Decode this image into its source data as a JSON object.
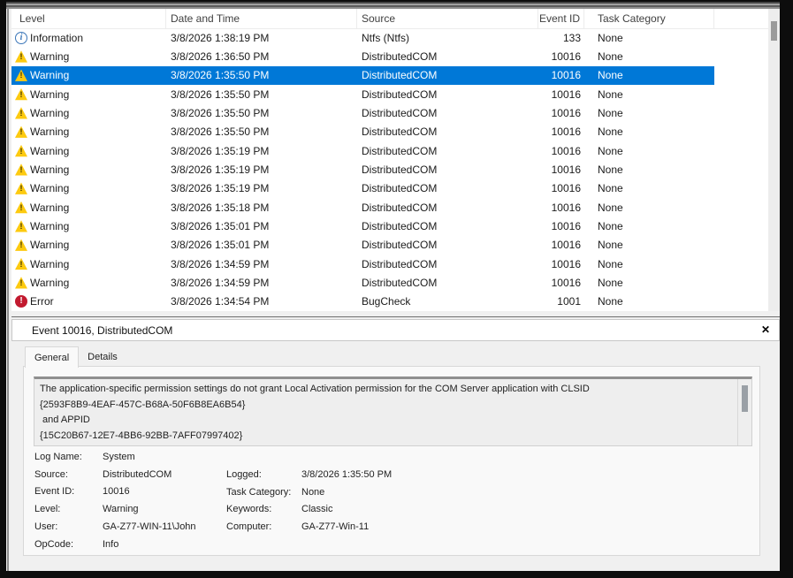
{
  "event_table": {
    "columns": [
      "Level",
      "Date and Time",
      "Source",
      "Event ID",
      "Task Category"
    ],
    "rows": [
      {
        "icon": "info",
        "level": "Information",
        "datetime": "3/8/2026 1:38:19 PM",
        "source": "Ntfs (Ntfs)",
        "event_id": "133",
        "task_category": "None",
        "selected": false
      },
      {
        "icon": "warning",
        "level": "Warning",
        "datetime": "3/8/2026 1:36:50 PM",
        "source": "DistributedCOM",
        "event_id": "10016",
        "task_category": "None",
        "selected": false
      },
      {
        "icon": "warning",
        "level": "Warning",
        "datetime": "3/8/2026 1:35:50 PM",
        "source": "DistributedCOM",
        "event_id": "10016",
        "task_category": "None",
        "selected": true
      },
      {
        "icon": "warning",
        "level": "Warning",
        "datetime": "3/8/2026 1:35:50 PM",
        "source": "DistributedCOM",
        "event_id": "10016",
        "task_category": "None",
        "selected": false
      },
      {
        "icon": "warning",
        "level": "Warning",
        "datetime": "3/8/2026 1:35:50 PM",
        "source": "DistributedCOM",
        "event_id": "10016",
        "task_category": "None",
        "selected": false
      },
      {
        "icon": "warning",
        "level": "Warning",
        "datetime": "3/8/2026 1:35:50 PM",
        "source": "DistributedCOM",
        "event_id": "10016",
        "task_category": "None",
        "selected": false
      },
      {
        "icon": "warning",
        "level": "Warning",
        "datetime": "3/8/2026 1:35:19 PM",
        "source": "DistributedCOM",
        "event_id": "10016",
        "task_category": "None",
        "selected": false
      },
      {
        "icon": "warning",
        "level": "Warning",
        "datetime": "3/8/2026 1:35:19 PM",
        "source": "DistributedCOM",
        "event_id": "10016",
        "task_category": "None",
        "selected": false
      },
      {
        "icon": "warning",
        "level": "Warning",
        "datetime": "3/8/2026 1:35:19 PM",
        "source": "DistributedCOM",
        "event_id": "10016",
        "task_category": "None",
        "selected": false
      },
      {
        "icon": "warning",
        "level": "Warning",
        "datetime": "3/8/2026 1:35:18 PM",
        "source": "DistributedCOM",
        "event_id": "10016",
        "task_category": "None",
        "selected": false
      },
      {
        "icon": "warning",
        "level": "Warning",
        "datetime": "3/8/2026 1:35:01 PM",
        "source": "DistributedCOM",
        "event_id": "10016",
        "task_category": "None",
        "selected": false
      },
      {
        "icon": "warning",
        "level": "Warning",
        "datetime": "3/8/2026 1:35:01 PM",
        "source": "DistributedCOM",
        "event_id": "10016",
        "task_category": "None",
        "selected": false
      },
      {
        "icon": "warning",
        "level": "Warning",
        "datetime": "3/8/2026 1:34:59 PM",
        "source": "DistributedCOM",
        "event_id": "10016",
        "task_category": "None",
        "selected": false
      },
      {
        "icon": "warning",
        "level": "Warning",
        "datetime": "3/8/2026 1:34:59 PM",
        "source": "DistributedCOM",
        "event_id": "10016",
        "task_category": "None",
        "selected": false
      },
      {
        "icon": "error",
        "level": "Error",
        "datetime": "3/8/2026 1:34:54 PM",
        "source": "BugCheck",
        "event_id": "1001",
        "task_category": "None",
        "selected": false
      }
    ]
  },
  "detail_pane": {
    "title": "Event 10016, DistributedCOM",
    "close_icon": "✕",
    "tabs": [
      "General",
      "Details"
    ],
    "active_tab": "General",
    "message_lines": [
      "The application-specific permission settings do not grant Local Activation permission for the COM Server application with CLSID",
      "{2593F8B9-4EAF-457C-B68A-50F6B8EA6B54}",
      " and APPID",
      "{15C20B67-12E7-4BB6-92BB-7AFF07997402}"
    ],
    "fields_left": [
      {
        "label": "Log Name:",
        "value": "System"
      },
      {
        "label": "Source:",
        "value": "DistributedCOM"
      },
      {
        "label": "Event ID:",
        "value": "10016"
      },
      {
        "label": "Level:",
        "value": "Warning"
      },
      {
        "label": "User:",
        "value": "GA-Z77-WIN-11\\John"
      },
      {
        "label": "OpCode:",
        "value": "Info"
      }
    ],
    "fields_right": [
      {
        "label": "Logged:",
        "value": "3/8/2026 1:35:50 PM"
      },
      {
        "label": "Task Category:",
        "value": "None"
      },
      {
        "label": "Keywords:",
        "value": "Classic"
      },
      {
        "label": "Computer:",
        "value": "GA-Z77-Win-11"
      }
    ]
  },
  "colors": {
    "selection": "#0078d7",
    "warning_icon": "#fdca0f",
    "error_icon": "#c21a2f",
    "info_icon": "#3a76b8"
  }
}
